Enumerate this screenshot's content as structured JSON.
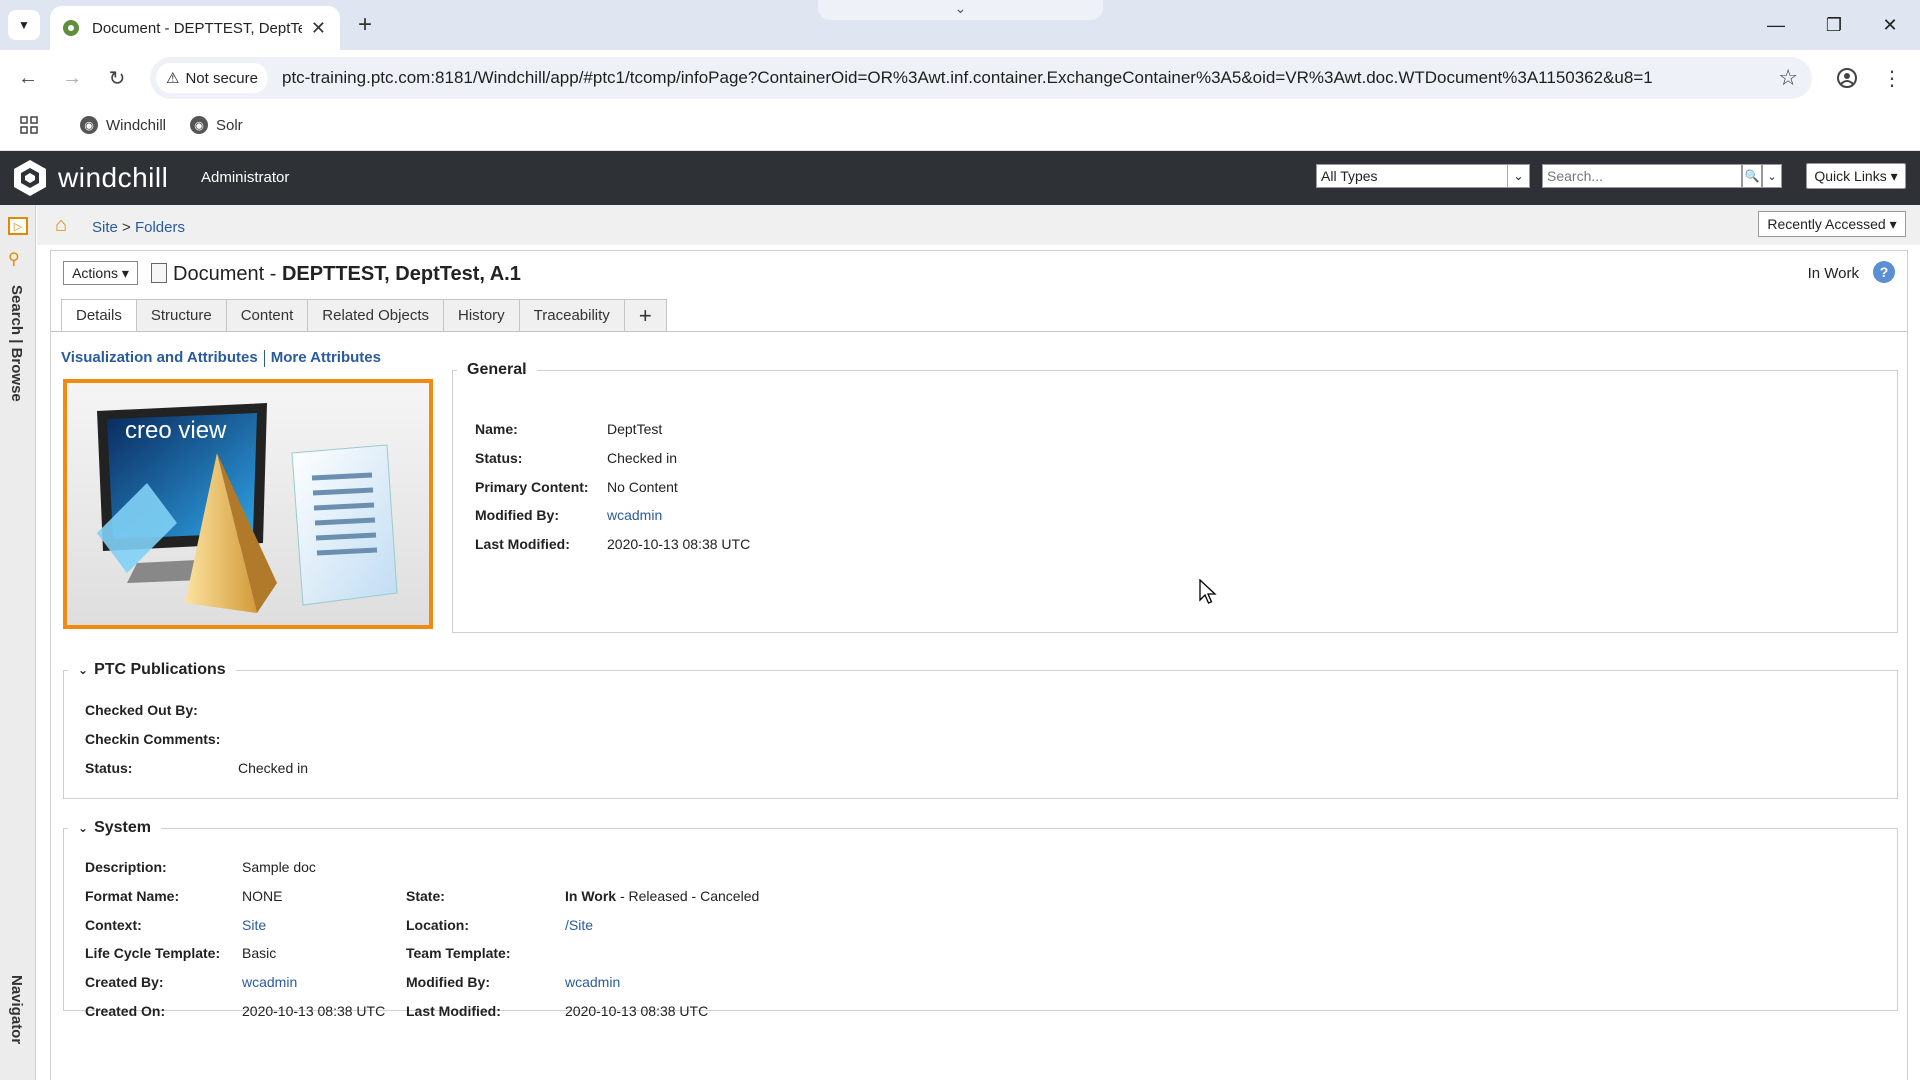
{
  "browser": {
    "tab_title": "Document - DEPTTEST, DeptTe",
    "not_secure": "Not secure",
    "url": "ptc-training.ptc.com:8181/Windchill/app/#ptc1/tcomp/infoPage?ContainerOid=OR%3Awt.inf.container.ExchangeContainer%3A5&oid=VR%3Awt.doc.WTDocument%3A1150362&u8=1",
    "bookmarks": [
      "Windchill",
      "Solr"
    ]
  },
  "header": {
    "brand": "windchill",
    "role": "Administrator",
    "types_value": "All Types",
    "search_placeholder": "Search...",
    "quick_links": "Quick Links ▾"
  },
  "left_rail": {
    "search_browse": "Search | Browse",
    "navigator": "Navigator"
  },
  "breadcrumb": {
    "site": "Site",
    "sep": ">",
    "folders": "Folders",
    "recently_accessed": "Recently Accessed ▾"
  },
  "page": {
    "actions": "Actions ▾",
    "title_prefix": "Document - ",
    "title_bold": "DEPTTEST, DeptTest, A.1",
    "state": "In Work",
    "help": "?"
  },
  "tabs": [
    "Details",
    "Structure",
    "Content",
    "Related Objects",
    "History",
    "Traceability"
  ],
  "subtabs": {
    "visualization": "Visualization and Attributes",
    "more": "More Attributes"
  },
  "thumbnail": {
    "logo_text": "creo view"
  },
  "general": {
    "legend": "General",
    "name_label": "Name:",
    "name": "DeptTest",
    "status_label": "Status:",
    "status": "Checked in",
    "primary_label": "Primary Content:",
    "primary": "No Content",
    "modified_by_label": "Modified By:",
    "modified_by": "wcadmin",
    "last_modified_label": "Last Modified:",
    "last_modified": "2020-10-13 08:38 UTC"
  },
  "ptc_publications": {
    "legend": "PTC Publications",
    "checked_out_label": "Checked Out By:",
    "checkin_comments_label": "Checkin Comments:",
    "status_label": "Status:",
    "status": "Checked in"
  },
  "system": {
    "legend": "System",
    "description_label": "Description:",
    "description": "Sample doc",
    "format_label": "Format Name:",
    "format": "NONE",
    "context_label": "Context:",
    "context": "Site",
    "lifecycle_label": "Life Cycle Template:",
    "lifecycle": "Basic",
    "created_by_label": "Created By:",
    "created_by": "wcadmin",
    "created_on_label": "Created On:",
    "created_on": "2020-10-13 08:38 UTC",
    "state_label": "State:",
    "state_current": "In Work",
    "state_rest": " - Released - Canceled",
    "location_label": "Location:",
    "location": "/Site",
    "team_label": "Team Template:",
    "modified_by_label": "Modified By:",
    "modified_by": "wcadmin",
    "last_modified_label": "Last Modified:",
    "last_modified": "2020-10-13 08:38 UTC"
  },
  "colors": {
    "header_bg": "#2e3236",
    "accent_orange": "#f28a0f",
    "link_blue": "#2a5b9f"
  }
}
